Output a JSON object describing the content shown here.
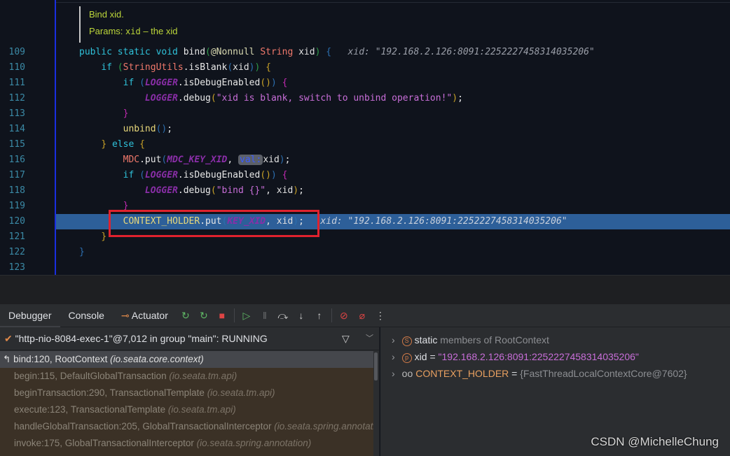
{
  "editor": {
    "doc": {
      "summary": "Bind xid.",
      "params_label": "Params:",
      "param_name": "xid",
      "param_desc": "– the xid"
    },
    "lines": [
      {
        "n": "109",
        "indent": 0,
        "tokens": [
          [
            "public static void ",
            "kw"
          ],
          [
            "bind",
            "fn"
          ],
          [
            "(",
            "p1"
          ],
          [
            "@Nonnull ",
            "ann"
          ],
          [
            "String ",
            "cls"
          ],
          [
            "xid",
            "id"
          ],
          [
            ")",
            "p1"
          ],
          [
            " {",
            "p2"
          ],
          [
            "   xid: \"192.168.2.126:8091:2252227458314035206\"",
            "hint"
          ]
        ]
      },
      {
        "n": "110",
        "indent": 1,
        "tokens": [
          [
            "if ",
            "kw"
          ],
          [
            "(",
            "p1"
          ],
          [
            "StringUtils",
            "cls"
          ],
          [
            ".isBlank",
            "fn"
          ],
          [
            "(",
            "p2"
          ],
          [
            "xid",
            "id"
          ],
          [
            ")",
            "p2"
          ],
          [
            ")",
            "p1"
          ],
          [
            " {",
            "p3"
          ]
        ]
      },
      {
        "n": "111",
        "indent": 2,
        "tokens": [
          [
            "if ",
            "kw"
          ],
          [
            "(",
            "p2"
          ],
          [
            "LOGGER",
            "const"
          ],
          [
            ".isDebugEnabled",
            "fn"
          ],
          [
            "(",
            "p3"
          ],
          [
            ")",
            "p3"
          ],
          [
            ")",
            "p2"
          ],
          [
            " {",
            "p4"
          ]
        ]
      },
      {
        "n": "112",
        "indent": 3,
        "tokens": [
          [
            "LOGGER",
            "const"
          ],
          [
            ".debug",
            "fn"
          ],
          [
            "(",
            "p3"
          ],
          [
            "\"xid is blank, switch to unbind operation!\"",
            "str"
          ],
          [
            ")",
            "p3"
          ],
          [
            ";",
            "fn"
          ]
        ]
      },
      {
        "n": "113",
        "indent": 2,
        "tokens": [
          [
            "}",
            "p4"
          ]
        ]
      },
      {
        "n": "114",
        "indent": 2,
        "tokens": [
          [
            "unbind",
            "call"
          ],
          [
            "(",
            "p2"
          ],
          [
            ")",
            "p2"
          ],
          [
            ";",
            "fn"
          ]
        ]
      },
      {
        "n": "115",
        "indent": 1,
        "tokens": [
          [
            "}",
            "p3"
          ],
          [
            " else ",
            "kw"
          ],
          [
            "{",
            "p3"
          ]
        ]
      },
      {
        "n": "116",
        "indent": 2,
        "tokens": [
          [
            "MDC",
            "mdc"
          ],
          [
            ".put",
            "fn"
          ],
          [
            "(",
            "p2"
          ],
          [
            "MDC_KEY_XID",
            "const"
          ],
          [
            ", ",
            "fn"
          ],
          [
            "val:",
            "pill"
          ],
          [
            "xid",
            "id"
          ],
          [
            ")",
            "p2"
          ],
          [
            ";",
            "fn"
          ]
        ]
      },
      {
        "n": "117",
        "indent": 2,
        "tokens": [
          [
            "if ",
            "kw"
          ],
          [
            "(",
            "p2"
          ],
          [
            "LOGGER",
            "const"
          ],
          [
            ".isDebugEnabled",
            "fn"
          ],
          [
            "(",
            "p3"
          ],
          [
            ")",
            "p3"
          ],
          [
            ")",
            "p2"
          ],
          [
            " {",
            "p4"
          ]
        ]
      },
      {
        "n": "118",
        "indent": 3,
        "tokens": [
          [
            "LOGGER",
            "const"
          ],
          [
            ".debug",
            "fn"
          ],
          [
            "(",
            "p3"
          ],
          [
            "\"bind {}\"",
            "str"
          ],
          [
            ", xid",
            "id"
          ],
          [
            ")",
            "p3"
          ],
          [
            ";",
            "fn"
          ]
        ]
      },
      {
        "n": "119",
        "indent": 2,
        "tokens": [
          [
            "}",
            "p4"
          ]
        ]
      },
      {
        "n": "120",
        "indent": 2,
        "current": true,
        "tokens": [
          [
            "CONTEXT_HOLDER",
            "call"
          ],
          [
            ".put",
            "fn"
          ],
          [
            "(",
            "p2"
          ],
          [
            "KEY_XID",
            "const"
          ],
          [
            ", xid",
            "id"
          ],
          [
            ")",
            "p2"
          ],
          [
            ";",
            "fn"
          ],
          [
            "   xid: \"192.168.2.126:8091:2252227458314035206\"",
            "hint"
          ]
        ]
      },
      {
        "n": "121",
        "indent": 1,
        "tokens": [
          [
            "}",
            "p3"
          ]
        ]
      },
      {
        "n": "122",
        "indent": 0,
        "tokens": [
          [
            "}",
            "p2"
          ]
        ]
      },
      {
        "n": "123",
        "indent": 0,
        "tokens": []
      }
    ]
  },
  "debug_toolbar": {
    "tabs": [
      "Debugger",
      "Console",
      "Actuator"
    ],
    "actuator_icon": "actuator-icon",
    "buttons": [
      "rerun-icon",
      "rerun-config-icon",
      "stop-icon",
      "resume-icon",
      "pause-icon",
      "step-over-icon",
      "step-into-icon",
      "step-out-icon",
      "view-breakpoints-icon",
      "mute-breakpoints-icon",
      "more-icon"
    ]
  },
  "thread": {
    "label": "\"http-nio-8084-exec-1\"@7,012 in group \"main\": RUNNING"
  },
  "frames": [
    {
      "method": "bind:120, RootContext",
      "pkg": "(io.seata.core.context)",
      "selected": true
    },
    {
      "method": "begin:115, DefaultGlobalTransaction",
      "pkg": "(io.seata.tm.api)"
    },
    {
      "method": "beginTransaction:290, TransactionalTemplate",
      "pkg": "(io.seata.tm.api)"
    },
    {
      "method": "execute:123, TransactionalTemplate",
      "pkg": "(io.seata.tm.api)"
    },
    {
      "method": "handleGlobalTransaction:205, GlobalTransactionalInterceptor",
      "pkg": "(io.seata.spring.annotation)"
    },
    {
      "method": "invoke:175, GlobalTransactionalInterceptor",
      "pkg": "(io.seata.spring.annotation)"
    }
  ],
  "variables": [
    {
      "badge": "S",
      "name": "static",
      "rest": " members of RootContext"
    },
    {
      "badge": "p",
      "name": "xid",
      "eq": " = ",
      "value": "\"192.168.2.126:8091:2252227458314035206\""
    },
    {
      "badge": "oo",
      "name": "CONTEXT_HOLDER",
      "eq": " = ",
      "value": "{FastThreadLocalContextCore@7602}"
    }
  ],
  "watermark": "CSDN @MichelleChung",
  "colors": {
    "current_line": "#2d5f99",
    "highlight_box": "#e0222e",
    "frames_bg": "#3b3126"
  }
}
